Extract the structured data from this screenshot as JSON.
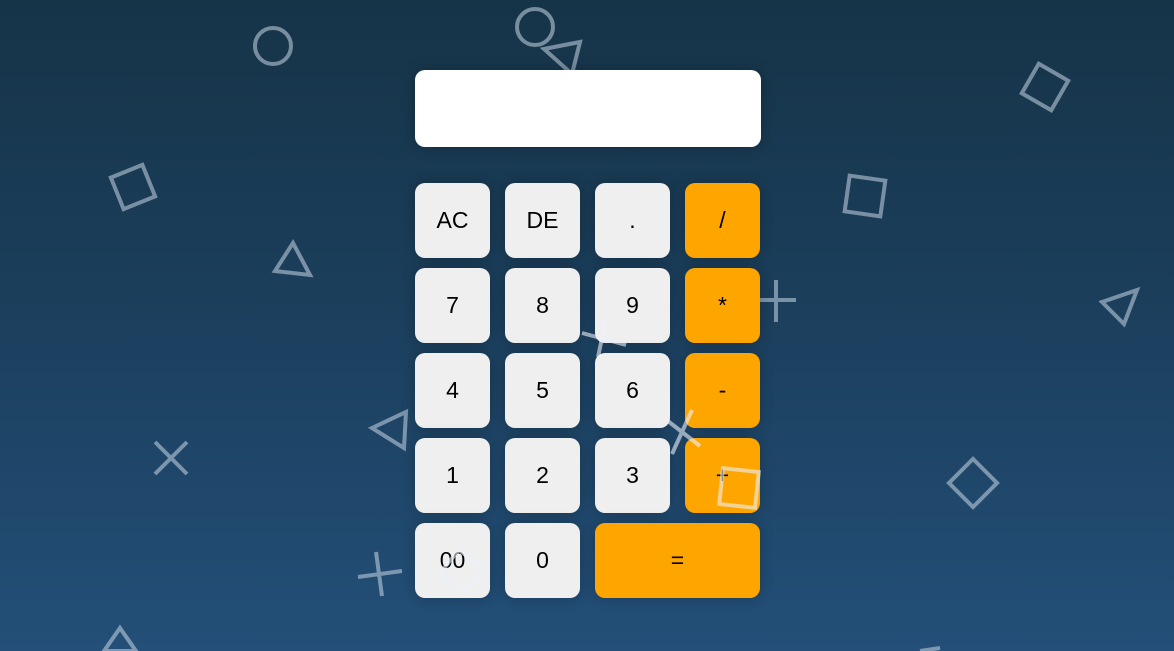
{
  "display": {
    "value": ""
  },
  "buttons": {
    "ac": "AC",
    "de": "DE",
    "dot": ".",
    "divide": "/",
    "seven": "7",
    "eight": "8",
    "nine": "9",
    "multiply": "*",
    "four": "4",
    "five": "5",
    "six": "6",
    "minus": "-",
    "one": "1",
    "two": "2",
    "three": "3",
    "plus": "+",
    "double_zero": "00",
    "zero": "0",
    "equals": "="
  },
  "colors": {
    "operator": "#ffa500",
    "key": "#efefef",
    "display": "#ffffff"
  }
}
